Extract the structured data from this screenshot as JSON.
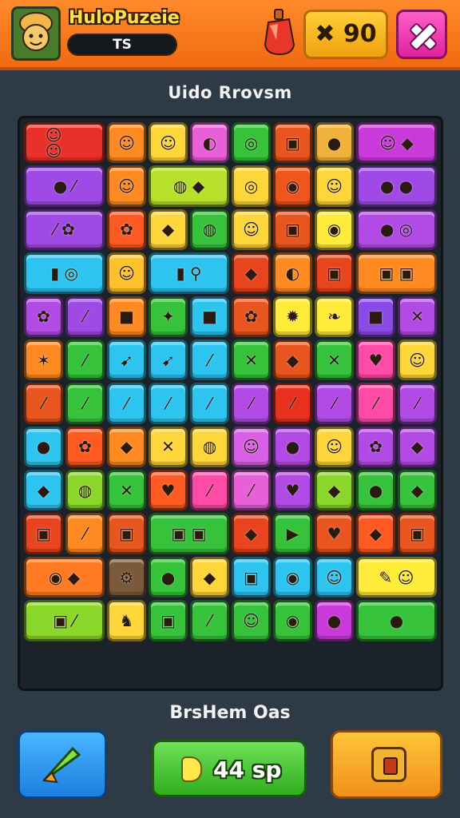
{
  "header": {
    "title": "HuloPuzeie",
    "player_name": "TS",
    "score": "✖ 90",
    "potion_icon": "potion-icon",
    "close_icon": "crossed-tools-icon"
  },
  "level_title": "Uido Rrovsm",
  "footer": {
    "label": "BrsHem Oas",
    "middle_button": "44 sp",
    "left_icon": "arrow-icon",
    "right_icon": "camera-icon"
  },
  "board": {
    "cols": 10,
    "rows": 13,
    "tiles": [
      {
        "r": 0,
        "c": 0,
        "w": 2,
        "h": 1,
        "color": "#e9312a",
        "glyph": "☺ ☺"
      },
      {
        "r": 0,
        "c": 2,
        "w": 1,
        "h": 1,
        "color": "#ff8a22",
        "glyph": "☺"
      },
      {
        "r": 0,
        "c": 3,
        "w": 1,
        "h": 1,
        "color": "#ffd63a",
        "glyph": "☺"
      },
      {
        "r": 0,
        "c": 4,
        "w": 1,
        "h": 1,
        "color": "#e85fd8",
        "glyph": "◐"
      },
      {
        "r": 0,
        "c": 5,
        "w": 1,
        "h": 1,
        "color": "#36c23a",
        "glyph": "◎"
      },
      {
        "r": 0,
        "c": 6,
        "w": 1,
        "h": 1,
        "color": "#e8551e",
        "glyph": "▣"
      },
      {
        "r": 0,
        "c": 7,
        "w": 1,
        "h": 1,
        "color": "#f0b13a",
        "glyph": "●"
      },
      {
        "r": 0,
        "c": 8,
        "w": 2,
        "h": 1,
        "color": "#c83ad9",
        "glyph": "☺ ◆"
      },
      {
        "r": 1,
        "c": 0,
        "w": 2,
        "h": 1,
        "color": "#a04ae6",
        "glyph": "● ⁄"
      },
      {
        "r": 1,
        "c": 2,
        "w": 1,
        "h": 1,
        "color": "#ff8a22",
        "glyph": "☺"
      },
      {
        "r": 1,
        "c": 3,
        "w": 2,
        "h": 1,
        "color": "#b6e02a",
        "glyph": "◍ ◆"
      },
      {
        "r": 1,
        "c": 5,
        "w": 1,
        "h": 1,
        "color": "#ffd63a",
        "glyph": "◎"
      },
      {
        "r": 1,
        "c": 6,
        "w": 1,
        "h": 1,
        "color": "#f0551e",
        "glyph": "◉"
      },
      {
        "r": 1,
        "c": 7,
        "w": 1,
        "h": 1,
        "color": "#ffd63a",
        "glyph": "☺"
      },
      {
        "r": 1,
        "c": 8,
        "w": 2,
        "h": 1,
        "color": "#a04ae6",
        "glyph": "● ●"
      },
      {
        "r": 2,
        "c": 0,
        "w": 2,
        "h": 1,
        "color": "#a04ae6",
        "glyph": "⁄ ✿"
      },
      {
        "r": 2,
        "c": 2,
        "w": 1,
        "h": 1,
        "color": "#ff5a22",
        "glyph": "✿"
      },
      {
        "r": 2,
        "c": 3,
        "w": 1,
        "h": 1,
        "color": "#ffd63a",
        "glyph": "◆"
      },
      {
        "r": 2,
        "c": 4,
        "w": 1,
        "h": 1,
        "color": "#36c23a",
        "glyph": "◍"
      },
      {
        "r": 2,
        "c": 5,
        "w": 1,
        "h": 1,
        "color": "#ffd63a",
        "glyph": "☺"
      },
      {
        "r": 2,
        "c": 6,
        "w": 1,
        "h": 1,
        "color": "#e8551e",
        "glyph": "▣"
      },
      {
        "r": 2,
        "c": 7,
        "w": 1,
        "h": 1,
        "color": "#ffec3a",
        "glyph": "◉"
      },
      {
        "r": 2,
        "c": 8,
        "w": 2,
        "h": 1,
        "color": "#b24ae6",
        "glyph": "● ◎"
      },
      {
        "r": 3,
        "c": 0,
        "w": 2,
        "h": 1,
        "color": "#2ec4f0",
        "glyph": "▮ ◎"
      },
      {
        "r": 3,
        "c": 2,
        "w": 1,
        "h": 1,
        "color": "#ffc22a",
        "glyph": "☺"
      },
      {
        "r": 3,
        "c": 3,
        "w": 2,
        "h": 1,
        "color": "#2ec4f0",
        "glyph": "▮ ⚲"
      },
      {
        "r": 3,
        "c": 5,
        "w": 1,
        "h": 1,
        "color": "#e8451e",
        "glyph": "◆"
      },
      {
        "r": 3,
        "c": 6,
        "w": 1,
        "h": 1,
        "color": "#ff8a22",
        "glyph": "◐"
      },
      {
        "r": 3,
        "c": 7,
        "w": 1,
        "h": 1,
        "color": "#e8451e",
        "glyph": "▣"
      },
      {
        "r": 3,
        "c": 8,
        "w": 2,
        "h": 1,
        "color": "#ff8a22",
        "glyph": "▣ ▣"
      },
      {
        "r": 4,
        "c": 0,
        "w": 1,
        "h": 1,
        "color": "#b24ae6",
        "glyph": "✿"
      },
      {
        "r": 4,
        "c": 1,
        "w": 1,
        "h": 1,
        "color": "#a04ae6",
        "glyph": "⁄"
      },
      {
        "r": 4,
        "c": 2,
        "w": 1,
        "h": 1,
        "color": "#ff8a22",
        "glyph": "■"
      },
      {
        "r": 4,
        "c": 3,
        "w": 1,
        "h": 1,
        "color": "#36c23a",
        "glyph": "✦"
      },
      {
        "r": 4,
        "c": 4,
        "w": 1,
        "h": 1,
        "color": "#2ec4f0",
        "glyph": "■"
      },
      {
        "r": 4,
        "c": 5,
        "w": 1,
        "h": 1,
        "color": "#e8551e",
        "glyph": "✿"
      },
      {
        "r": 4,
        "c": 6,
        "w": 1,
        "h": 1,
        "color": "#ffec3a",
        "glyph": "✹"
      },
      {
        "r": 4,
        "c": 7,
        "w": 1,
        "h": 1,
        "color": "#ffec3a",
        "glyph": "❧"
      },
      {
        "r": 4,
        "c": 8,
        "w": 1,
        "h": 1,
        "color": "#8a4ae6",
        "glyph": "■"
      },
      {
        "r": 4,
        "c": 9,
        "w": 1,
        "h": 1,
        "color": "#b24ae6",
        "glyph": "✕"
      },
      {
        "r": 5,
        "c": 0,
        "w": 1,
        "h": 1,
        "color": "#ff8a22",
        "glyph": "✶"
      },
      {
        "r": 5,
        "c": 1,
        "w": 1,
        "h": 1,
        "color": "#36c23a",
        "glyph": "⁄"
      },
      {
        "r": 5,
        "c": 2,
        "w": 1,
        "h": 1,
        "color": "#2ec4f0",
        "glyph": "➹"
      },
      {
        "r": 5,
        "c": 3,
        "w": 1,
        "h": 1,
        "color": "#2ec4f0",
        "glyph": "➹"
      },
      {
        "r": 5,
        "c": 4,
        "w": 1,
        "h": 1,
        "color": "#2ec4f0",
        "glyph": "⁄"
      },
      {
        "r": 5,
        "c": 5,
        "w": 1,
        "h": 1,
        "color": "#36c23a",
        "glyph": "✕"
      },
      {
        "r": 5,
        "c": 6,
        "w": 1,
        "h": 1,
        "color": "#e8551e",
        "glyph": "◆"
      },
      {
        "r": 5,
        "c": 7,
        "w": 1,
        "h": 1,
        "color": "#36c23a",
        "glyph": "✕"
      },
      {
        "r": 5,
        "c": 8,
        "w": 1,
        "h": 1,
        "color": "#ff4aa8",
        "glyph": "♥"
      },
      {
        "r": 5,
        "c": 9,
        "w": 1,
        "h": 1,
        "color": "#ffd63a",
        "glyph": "☺"
      },
      {
        "r": 6,
        "c": 0,
        "w": 1,
        "h": 1,
        "color": "#e8551e",
        "glyph": "⁄"
      },
      {
        "r": 6,
        "c": 1,
        "w": 1,
        "h": 1,
        "color": "#36c23a",
        "glyph": "⁄"
      },
      {
        "r": 6,
        "c": 2,
        "w": 1,
        "h": 1,
        "color": "#2ec4f0",
        "glyph": "⁄"
      },
      {
        "r": 6,
        "c": 3,
        "w": 1,
        "h": 1,
        "color": "#2ec4f0",
        "glyph": "⁄"
      },
      {
        "r": 6,
        "c": 4,
        "w": 1,
        "h": 1,
        "color": "#2ec4f0",
        "glyph": "⁄"
      },
      {
        "r": 6,
        "c": 5,
        "w": 1,
        "h": 1,
        "color": "#b24ae6",
        "glyph": "⁄"
      },
      {
        "r": 6,
        "c": 6,
        "w": 1,
        "h": 1,
        "color": "#e8301e",
        "glyph": "⁄"
      },
      {
        "r": 6,
        "c": 7,
        "w": 1,
        "h": 1,
        "color": "#b24ae6",
        "glyph": "⁄"
      },
      {
        "r": 6,
        "c": 8,
        "w": 1,
        "h": 1,
        "color": "#ff4aa8",
        "glyph": "⁄"
      },
      {
        "r": 6,
        "c": 9,
        "w": 1,
        "h": 1,
        "color": "#b24ae6",
        "glyph": "⁄"
      },
      {
        "r": 7,
        "c": 0,
        "w": 1,
        "h": 1,
        "color": "#2ec4f0",
        "glyph": "●"
      },
      {
        "r": 7,
        "c": 1,
        "w": 1,
        "h": 1,
        "color": "#ff5a22",
        "glyph": "✿"
      },
      {
        "r": 7,
        "c": 2,
        "w": 1,
        "h": 1,
        "color": "#ff8a22",
        "glyph": "◆"
      },
      {
        "r": 7,
        "c": 3,
        "w": 1,
        "h": 1,
        "color": "#ffd63a",
        "glyph": "✕"
      },
      {
        "r": 7,
        "c": 4,
        "w": 1,
        "h": 1,
        "color": "#ffd63a",
        "glyph": "◍"
      },
      {
        "r": 7,
        "c": 5,
        "w": 1,
        "h": 1,
        "color": "#d85fe8",
        "glyph": "☺"
      },
      {
        "r": 7,
        "c": 6,
        "w": 1,
        "h": 1,
        "color": "#b24ae6",
        "glyph": "●"
      },
      {
        "r": 7,
        "c": 7,
        "w": 1,
        "h": 1,
        "color": "#ffd63a",
        "glyph": "☺"
      },
      {
        "r": 7,
        "c": 8,
        "w": 1,
        "h": 1,
        "color": "#b24ae6",
        "glyph": "✿"
      },
      {
        "r": 7,
        "c": 9,
        "w": 1,
        "h": 1,
        "color": "#b24ae6",
        "glyph": "◆"
      },
      {
        "r": 8,
        "c": 0,
        "w": 1,
        "h": 1,
        "color": "#2ec4f0",
        "glyph": "◆"
      },
      {
        "r": 8,
        "c": 1,
        "w": 1,
        "h": 1,
        "color": "#8ad62a",
        "glyph": "◍"
      },
      {
        "r": 8,
        "c": 2,
        "w": 1,
        "h": 1,
        "color": "#36c23a",
        "glyph": "✕"
      },
      {
        "r": 8,
        "c": 3,
        "w": 1,
        "h": 1,
        "color": "#ff5a22",
        "glyph": "♥"
      },
      {
        "r": 8,
        "c": 4,
        "w": 1,
        "h": 1,
        "color": "#ff4aa8",
        "glyph": "⁄"
      },
      {
        "r": 8,
        "c": 5,
        "w": 1,
        "h": 1,
        "color": "#e85fd8",
        "glyph": "⁄"
      },
      {
        "r": 8,
        "c": 6,
        "w": 1,
        "h": 1,
        "color": "#b24ae6",
        "glyph": "♥"
      },
      {
        "r": 8,
        "c": 7,
        "w": 1,
        "h": 1,
        "color": "#8ad62a",
        "glyph": "◆"
      },
      {
        "r": 8,
        "c": 8,
        "w": 1,
        "h": 1,
        "color": "#36c23a",
        "glyph": "●"
      },
      {
        "r": 8,
        "c": 9,
        "w": 1,
        "h": 1,
        "color": "#36c23a",
        "glyph": "◆"
      },
      {
        "r": 9,
        "c": 0,
        "w": 1,
        "h": 1,
        "color": "#e8451e",
        "glyph": "▣"
      },
      {
        "r": 9,
        "c": 1,
        "w": 1,
        "h": 1,
        "color": "#ff8a22",
        "glyph": "⁄"
      },
      {
        "r": 9,
        "c": 2,
        "w": 1,
        "h": 1,
        "color": "#e8551e",
        "glyph": "▣"
      },
      {
        "r": 9,
        "c": 3,
        "w": 2,
        "h": 1,
        "color": "#36c23a",
        "glyph": "▣ ▣"
      },
      {
        "r": 9,
        "c": 5,
        "w": 1,
        "h": 1,
        "color": "#e8451e",
        "glyph": "◆"
      },
      {
        "r": 9,
        "c": 6,
        "w": 1,
        "h": 1,
        "color": "#36c23a",
        "glyph": "▶"
      },
      {
        "r": 9,
        "c": 7,
        "w": 1,
        "h": 1,
        "color": "#e8551e",
        "glyph": "♥"
      },
      {
        "r": 9,
        "c": 8,
        "w": 1,
        "h": 1,
        "color": "#ff5a22",
        "glyph": "◆"
      },
      {
        "r": 9,
        "c": 9,
        "w": 1,
        "h": 1,
        "color": "#e8551e",
        "glyph": "▣"
      },
      {
        "r": 10,
        "c": 0,
        "w": 2,
        "h": 1,
        "color": "#ff7a22",
        "glyph": "◉ ◆"
      },
      {
        "r": 10,
        "c": 2,
        "w": 1,
        "h": 1,
        "color": "#7a5a3a",
        "glyph": "⚙"
      },
      {
        "r": 10,
        "c": 3,
        "w": 1,
        "h": 1,
        "color": "#36c23a",
        "glyph": "●"
      },
      {
        "r": 10,
        "c": 4,
        "w": 1,
        "h": 1,
        "color": "#ffd63a",
        "glyph": "◆"
      },
      {
        "r": 10,
        "c": 5,
        "w": 1,
        "h": 1,
        "color": "#2ec4f0",
        "glyph": "▣"
      },
      {
        "r": 10,
        "c": 6,
        "w": 1,
        "h": 1,
        "color": "#2ec4f0",
        "glyph": "◉"
      },
      {
        "r": 10,
        "c": 7,
        "w": 1,
        "h": 1,
        "color": "#2ec4f0",
        "glyph": "☺"
      },
      {
        "r": 10,
        "c": 8,
        "w": 2,
        "h": 1,
        "color": "#ffec3a",
        "glyph": "✎ ☺"
      },
      {
        "r": 11,
        "c": 0,
        "w": 2,
        "h": 1,
        "color": "#8ad62a",
        "glyph": "▣ ⁄"
      },
      {
        "r": 11,
        "c": 2,
        "w": 1,
        "h": 1,
        "color": "#ffd63a",
        "glyph": "♞"
      },
      {
        "r": 11,
        "c": 3,
        "w": 1,
        "h": 1,
        "color": "#36c23a",
        "glyph": "▣"
      },
      {
        "r": 11,
        "c": 4,
        "w": 1,
        "h": 1,
        "color": "#36c23a",
        "glyph": "⁄"
      },
      {
        "r": 11,
        "c": 5,
        "w": 1,
        "h": 1,
        "color": "#36c23a",
        "glyph": "☺"
      },
      {
        "r": 11,
        "c": 6,
        "w": 1,
        "h": 1,
        "color": "#36c23a",
        "glyph": "◉"
      },
      {
        "r": 11,
        "c": 7,
        "w": 1,
        "h": 1,
        "color": "#c83ad9",
        "glyph": "●"
      },
      {
        "r": 11,
        "c": 8,
        "w": 2,
        "h": 1,
        "color": "#36c23a",
        "glyph": "●"
      }
    ]
  }
}
